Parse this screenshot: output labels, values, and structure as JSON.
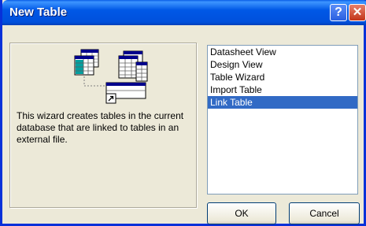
{
  "window": {
    "title": "New Table",
    "help_glyph": "?",
    "close_glyph": "✕"
  },
  "description": "This wizard creates tables in the current database that are linked to tables in an external file.",
  "list": {
    "items": [
      {
        "label": "Datasheet View"
      },
      {
        "label": "Design View"
      },
      {
        "label": "Table Wizard"
      },
      {
        "label": "Import Table"
      },
      {
        "label": "Link Table"
      }
    ],
    "selected": "Link Table"
  },
  "buttons": {
    "ok_label": "OK",
    "cancel_label": "Cancel"
  },
  "colors": {
    "titlebar": "#0058e6",
    "selection": "#316ac5",
    "dialog_bg": "#ece9d8"
  },
  "icons": [
    "help-icon",
    "close-icon",
    "linked-tables-illustration",
    "shortcut-arrow-icon"
  ]
}
